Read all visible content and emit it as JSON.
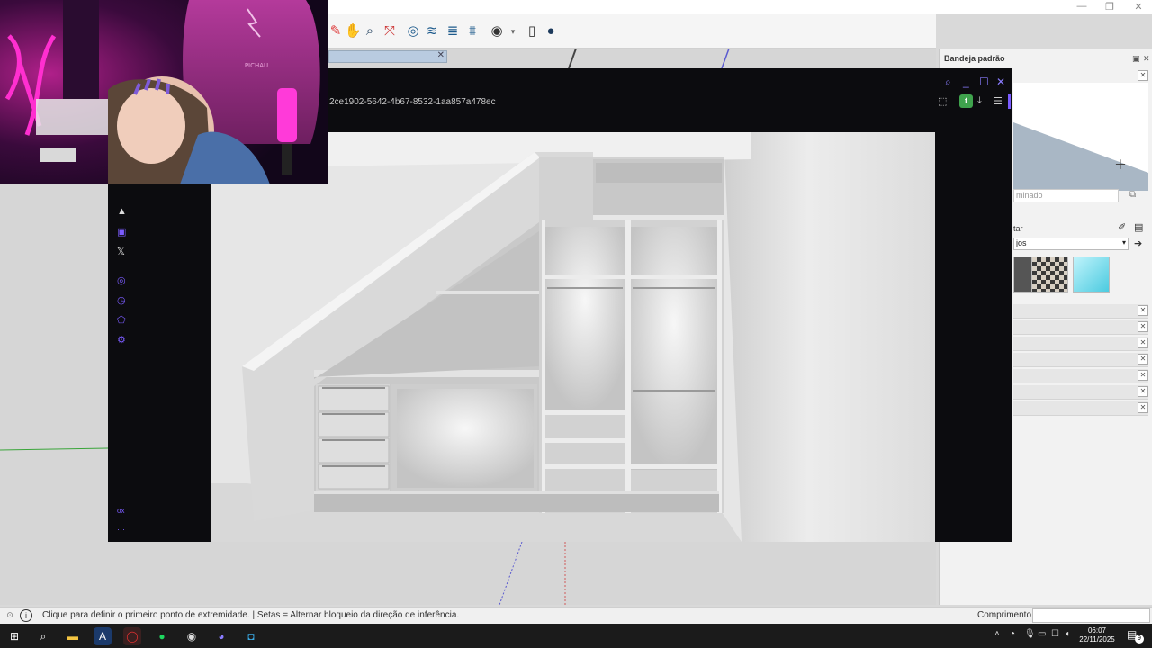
{
  "window": {
    "minimize": "—",
    "restore": "❐",
    "close": "✕"
  },
  "toolbar": {
    "tools": [
      "paint-icon",
      "hand-icon",
      "zoom-icon",
      "zoom-extents-icon",
      "orbit-icon",
      "sandbox-icon",
      "layers-icon",
      "stack-icon",
      "user-circle-icon",
      "dropdown-icon",
      "document-icon",
      "person-icon"
    ]
  },
  "tray": {
    "title": "Bandeja padrão",
    "name_placeholder": "minado",
    "tab_label": "tar",
    "dropdown_value": "jos",
    "rows": 7
  },
  "statusbar": {
    "hint": "Clique para definir o primeiro ponto de extremidade. | Setas = Alternar bloqueio da direção de inferência.",
    "measure_label": "Comprimento",
    "measure_value": ""
  },
  "viewer": {
    "filename": "2ce1902-5642-4b67-8532-1aa857a478ec",
    "avatar_letter": "t",
    "sidebar_bottom_label": "ox"
  },
  "taskbar": {
    "time": "06:07",
    "date": "22/11/2025",
    "notifications": "9"
  },
  "colors": {
    "accent": "#7b5cff",
    "viewer_bg": "#0c0c0f",
    "taskbar_bg": "#1b1b1b",
    "webcam_neon": "#ff2fd0"
  }
}
